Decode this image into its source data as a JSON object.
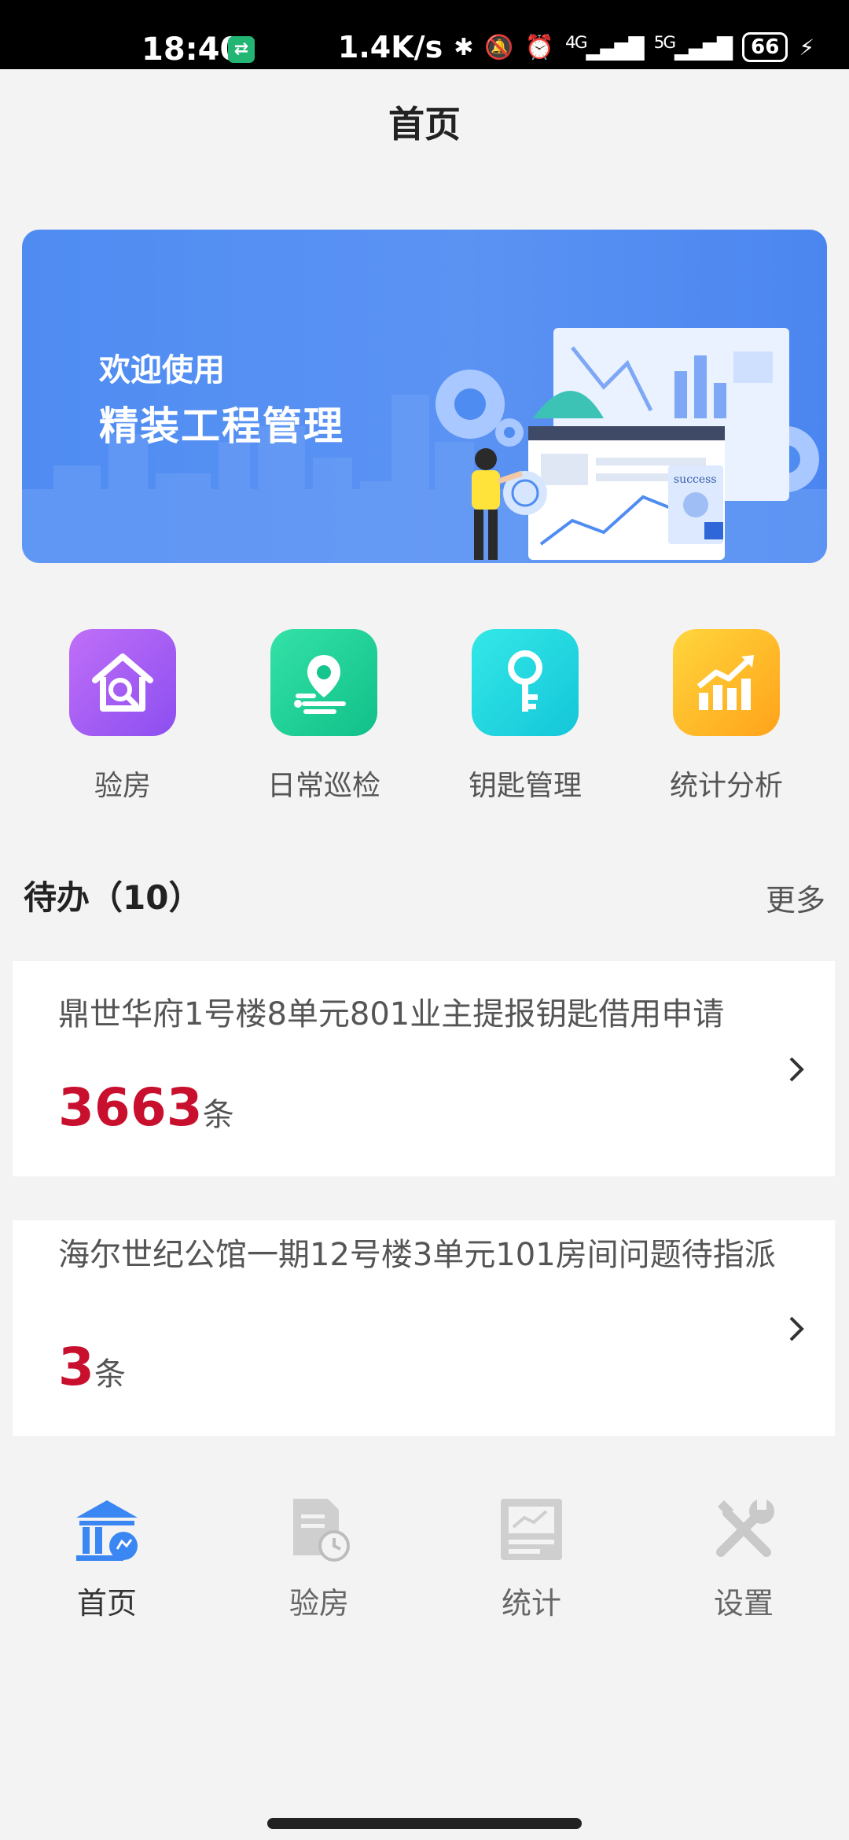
{
  "status_bar": {
    "time": "18:40",
    "app_icon": "app-notification-icon",
    "net_speed": "1.4K/s",
    "sig1_label": "4G",
    "sig2_label": "5G",
    "battery": "66"
  },
  "nav": {
    "title": "首页"
  },
  "banner": {
    "subtitle": "欢迎使用",
    "title": "精装工程管理",
    "badge_text": "success"
  },
  "quick_menu": [
    {
      "label": "验房",
      "icon": "house-inspect-icon",
      "color_from": "#b467f5",
      "color_to": "#8a48ee"
    },
    {
      "label": "日常巡检",
      "icon": "location-route-icon",
      "color_from": "#2fe0a5",
      "color_to": "#12c28a"
    },
    {
      "label": "钥匙管理",
      "icon": "key-icon",
      "color_from": "#2ee6e6",
      "color_to": "#16c7d9"
    },
    {
      "label": "统计分析",
      "icon": "chart-growth-icon",
      "color_from": "#ffd23a",
      "color_to": "#ffa61a"
    }
  ],
  "todo": {
    "title": "待办（10）",
    "more": "更多",
    "items": [
      {
        "title": "鼎世华府1号楼8单元801业主提报钥匙借用申请",
        "count": "3663",
        "unit": "条"
      },
      {
        "title": "海尔世纪公馆一期12号楼3单元101房间问题待指派",
        "count": "3",
        "unit": "条"
      }
    ]
  },
  "tabs": [
    {
      "label": "首页",
      "icon": "home-building-icon",
      "active": true
    },
    {
      "label": "验房",
      "icon": "document-clock-icon",
      "active": false
    },
    {
      "label": "统计",
      "icon": "chart-board-icon",
      "active": false
    },
    {
      "label": "设置",
      "icon": "tools-icon",
      "active": false
    }
  ],
  "colors": {
    "accent": "#3a86f2",
    "count_red": "#c8102e"
  }
}
